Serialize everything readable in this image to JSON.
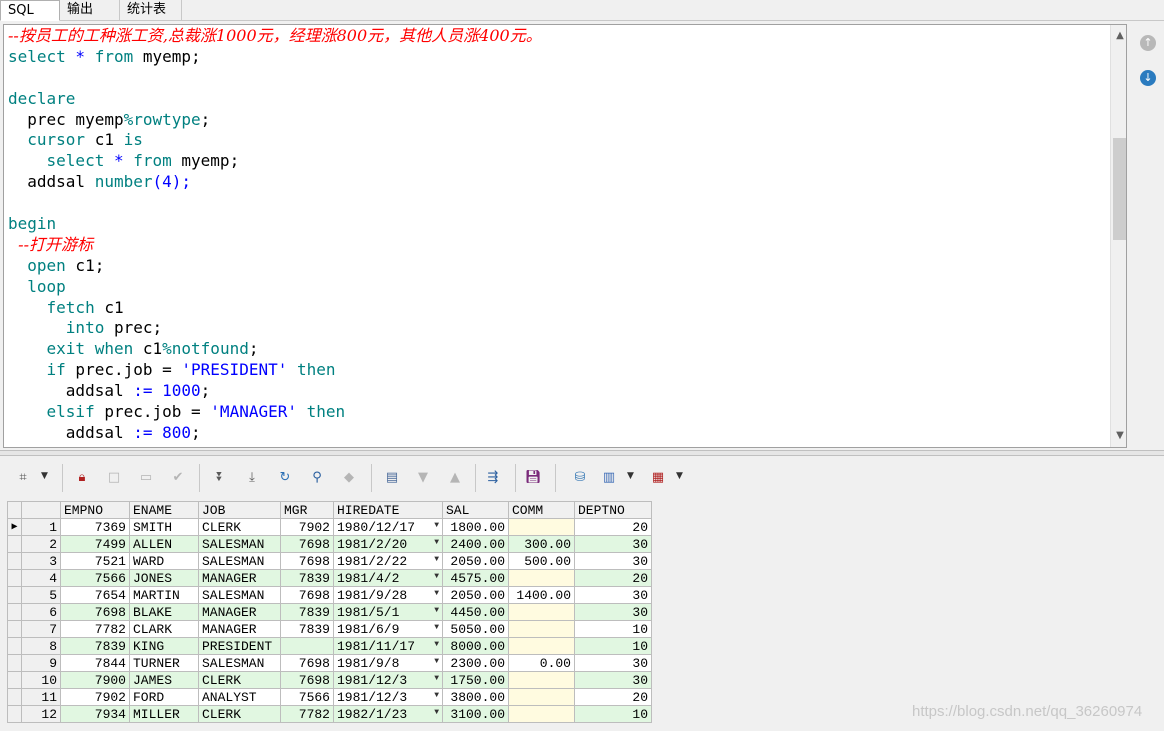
{
  "tabs": [
    {
      "label": "SQL"
    },
    {
      "label": "输出"
    },
    {
      "label": "统计表"
    }
  ],
  "editor": {
    "lines": {
      "l1": {
        "comment": "--按员工的工种涨工资,总裁涨1000元，经理涨800元，其他人员涨400元。"
      },
      "l2": {
        "a": "select",
        "b": " * ",
        "c": "from",
        "d": " myemp;"
      },
      "l4": {
        "a": "declare"
      },
      "l5": {
        "a": "  prec myemp",
        "b": "%rowtype",
        "c": ";"
      },
      "l6": {
        "a": "  ",
        "b": "cursor",
        "c": " c1 ",
        "d": "is"
      },
      "l7": {
        "a": "    ",
        "b": "select",
        "c": " * ",
        "d": "from",
        "e": " myemp;"
      },
      "l8": {
        "a": "  addsal ",
        "b": "number",
        "c": "(",
        "d": "4",
        "e": ");"
      },
      "l10": {
        "a": "begin"
      },
      "l11": {
        "comment": "  --打开游标"
      },
      "l12": {
        "a": "  ",
        "b": "open",
        "c": " c1;"
      },
      "l13": {
        "a": "  ",
        "b": "loop"
      },
      "l14": {
        "a": "    ",
        "b": "fetch",
        "c": " c1"
      },
      "l15": {
        "a": "      ",
        "b": "into",
        "c": " prec;"
      },
      "l16": {
        "a": "    ",
        "b": "exit when",
        "c": " c1",
        "d": "%notfound",
        "e": ";"
      },
      "l17": {
        "a": "    ",
        "b": "if",
        "c": " prec.job = ",
        "d": "'PRESIDENT'",
        "e": " then"
      },
      "l18": {
        "a": "      addsal ",
        "b": ":=",
        "c": " ",
        "d": "1000",
        "e": ";"
      },
      "l19": {
        "a": "    ",
        "b": "elsif",
        "c": " prec.job = ",
        "d": "'MANAGER'",
        "e": " then"
      },
      "l20": {
        "a": "      addsal ",
        "b": ":=",
        "c": " ",
        "d": "800",
        "e": ";"
      }
    }
  },
  "colors": {
    "keyword": "#008080",
    "comment": "#ff0000",
    "string": "#0000ff",
    "row_alt": "#e1f7e1",
    "empty_comm": "#fffbe0"
  },
  "toolbar": {
    "icons": [
      "grid-select-icon",
      "lock-icon",
      "add-row-icon",
      "delete-row-icon",
      "post-icon",
      "next-icon",
      "last-icon",
      "refresh-icon",
      "find-icon",
      "clear-icon",
      "query-by-example-icon",
      "filter-down-icon",
      "filter-up-icon",
      "link-icon",
      "save-icon",
      "export-icon",
      "chart-icon",
      "table-icon"
    ]
  },
  "grid": {
    "columns": [
      "EMPNO",
      "ENAME",
      "JOB",
      "MGR",
      "HIREDATE",
      "SAL",
      "COMM",
      "DEPTNO"
    ],
    "rows": [
      {
        "n": "1",
        "empno": "7369",
        "ename": "SMITH",
        "job": "CLERK",
        "mgr": "7902",
        "hiredate": "1980/12/17",
        "sal": "1800.00",
        "comm": "",
        "deptno": "20"
      },
      {
        "n": "2",
        "empno": "7499",
        "ename": "ALLEN",
        "job": "SALESMAN",
        "mgr": "7698",
        "hiredate": "1981/2/20",
        "sal": "2400.00",
        "comm": "300.00",
        "deptno": "30"
      },
      {
        "n": "3",
        "empno": "7521",
        "ename": "WARD",
        "job": "SALESMAN",
        "mgr": "7698",
        "hiredate": "1981/2/22",
        "sal": "2050.00",
        "comm": "500.00",
        "deptno": "30"
      },
      {
        "n": "4",
        "empno": "7566",
        "ename": "JONES",
        "job": "MANAGER",
        "mgr": "7839",
        "hiredate": "1981/4/2",
        "sal": "4575.00",
        "comm": "",
        "deptno": "20"
      },
      {
        "n": "5",
        "empno": "7654",
        "ename": "MARTIN",
        "job": "SALESMAN",
        "mgr": "7698",
        "hiredate": "1981/9/28",
        "sal": "2050.00",
        "comm": "1400.00",
        "deptno": "30"
      },
      {
        "n": "6",
        "empno": "7698",
        "ename": "BLAKE",
        "job": "MANAGER",
        "mgr": "7839",
        "hiredate": "1981/5/1",
        "sal": "4450.00",
        "comm": "",
        "deptno": "30"
      },
      {
        "n": "7",
        "empno": "7782",
        "ename": "CLARK",
        "job": "MANAGER",
        "mgr": "7839",
        "hiredate": "1981/6/9",
        "sal": "5050.00",
        "comm": "",
        "deptno": "10"
      },
      {
        "n": "8",
        "empno": "7839",
        "ename": "KING",
        "job": "PRESIDENT",
        "mgr": "",
        "hiredate": "1981/11/17",
        "sal": "8000.00",
        "comm": "",
        "deptno": "10"
      },
      {
        "n": "9",
        "empno": "7844",
        "ename": "TURNER",
        "job": "SALESMAN",
        "mgr": "7698",
        "hiredate": "1981/9/8",
        "sal": "2300.00",
        "comm": "0.00",
        "deptno": "30"
      },
      {
        "n": "10",
        "empno": "7900",
        "ename": "JAMES",
        "job": "CLERK",
        "mgr": "7698",
        "hiredate": "1981/12/3",
        "sal": "1750.00",
        "comm": "",
        "deptno": "30"
      },
      {
        "n": "11",
        "empno": "7902",
        "ename": "FORD",
        "job": "ANALYST",
        "mgr": "7566",
        "hiredate": "1981/12/3",
        "sal": "3800.00",
        "comm": "",
        "deptno": "20"
      },
      {
        "n": "12",
        "empno": "7934",
        "ename": "MILLER",
        "job": "CLERK",
        "mgr": "7782",
        "hiredate": "1982/1/23",
        "sal": "3100.00",
        "comm": "",
        "deptno": "10"
      }
    ]
  },
  "watermark": "https://blog.csdn.net/qq_36260974"
}
